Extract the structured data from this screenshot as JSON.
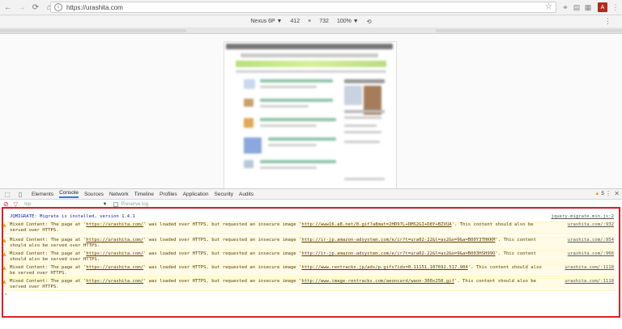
{
  "browser": {
    "url": "https://urashita.com",
    "back_icon": "back-arrow-icon",
    "forward_icon": "forward-arrow-icon",
    "reload_icon": "reload-icon",
    "home_icon": "home-icon",
    "info_icon": "info-icon",
    "star_icon": "star-icon"
  },
  "device_toolbar": {
    "device": "Nexus 6P ▼",
    "width": "412",
    "times": "×",
    "height": "732",
    "zoom": "100% ▼"
  },
  "devtools": {
    "tabs": [
      "Elements",
      "Console",
      "Sources",
      "Network",
      "Timeline",
      "Profiles",
      "Application",
      "Security",
      "Audits"
    ],
    "active_tab": "Console",
    "warn_count": "5",
    "filter": {
      "context": "top",
      "preserve_log": "Preserve log"
    },
    "messages": [
      {
        "type": "info",
        "text": "JQMIGRATE: Migrate is installed, version 1.4.1",
        "source": "jquery-migrate.min.js:2"
      },
      {
        "type": "warn",
        "pre": "Mixed Content: The page at '",
        "page": "https://urashita.com/",
        "mid": "' was loaded over HTTPS, but requested an insecure image '",
        "resource": "http://www16.a8.net/0.gif?a8mat=2HD97L+DMS2GI+D8Y+BZVUA",
        "post": "'. This content should also be served over HTTPS.",
        "source": "urashita.com/:932"
      },
      {
        "type": "warn",
        "pre": "Mixed Content: The page at '",
        "page": "https://urashita.com/",
        "mid": "' was loaded over HTTPS, but requested an insecure image '",
        "resource": "http://ir-jp.amazon-adsystem.com/e/ir?t=ura02-22&l=as2&o=9&a=B00Y3THKKM",
        "post": "'. This content should also be served over HTTPS.",
        "source": "urashita.com/:954"
      },
      {
        "type": "warn",
        "pre": "Mixed Content: The page at '",
        "page": "https://urashita.com/",
        "mid": "' was loaded over HTTPS, but requested an insecure image '",
        "resource": "http://ir-jp.amazon-adsystem.com/e/ir?t=ura02-22&l=as2&o=9&a=B003HSH99O",
        "post": "'. This content should also be served over HTTPS.",
        "source": "urashita.com/:966"
      },
      {
        "type": "warn",
        "pre": "Mixed Content: The page at '",
        "page": "https://urashita.com/",
        "mid": "' was loaded over HTTPS, but requested an insecure image '",
        "resource": "http://www.rentracks.jp/adx/p.gifx?idx=0.11151.107692.517.904",
        "post": "'. This content should also be served over HTTPS.",
        "source": "urashita.com/:1118"
      },
      {
        "type": "warn",
        "pre": "Mixed Content: The page at '",
        "page": "https://urashita.com/",
        "mid": "' was loaded over HTTPS, but requested an insecure image '",
        "resource": "http://www.image-rentracks.com/aeoncard/waon-300x250.gif",
        "post": "'. This content should also be served over HTTPS.",
        "source": "urashita.com/:1118"
      }
    ],
    "prompt": "›"
  },
  "colors": {
    "highlight_border": "#e02020",
    "warn_bg": "#fffbe6",
    "info_text": "#1a1aa6",
    "active_tab": "#3879d9"
  }
}
